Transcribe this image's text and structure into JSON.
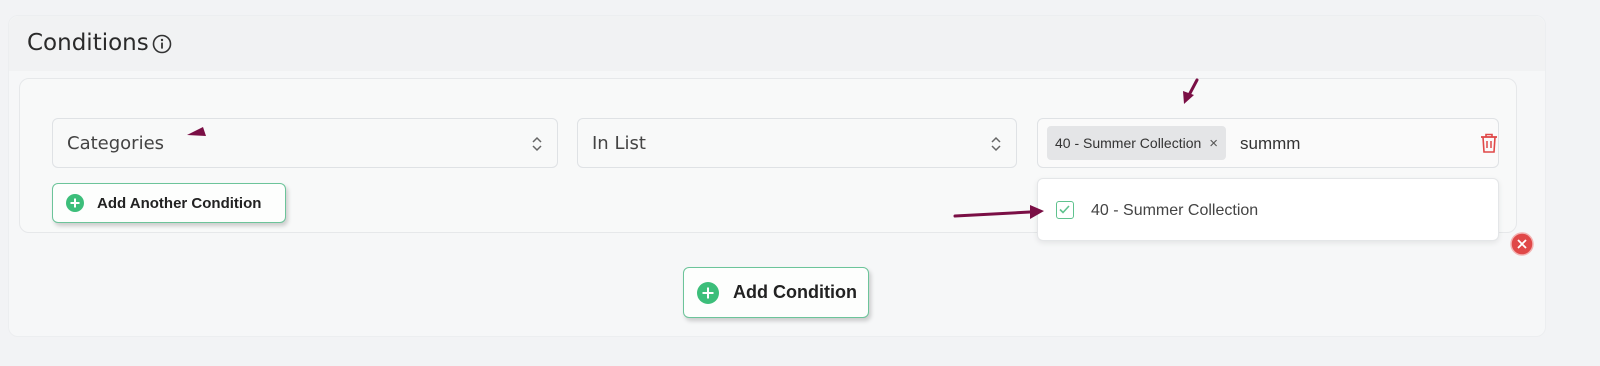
{
  "panel": {
    "title": "Conditions",
    "info_icon": "info-circle-icon"
  },
  "condition": {
    "field": {
      "value": "Categories"
    },
    "operator": {
      "value": "In List"
    },
    "values": {
      "tags": [
        {
          "label": "40 - Summer Collection",
          "remove_glyph": "×"
        }
      ],
      "search_text": "summm"
    },
    "delete_icon": "trash-icon"
  },
  "dropdown": {
    "options": [
      {
        "label": "40 - Summer Collection",
        "checked": true
      }
    ]
  },
  "buttons": {
    "add_another": "Add Another Condition",
    "add_condition": "Add Condition"
  },
  "colors": {
    "accent_green": "#3cbe7a",
    "annotation_arrow": "#7a0f45",
    "danger_red": "#e04848"
  }
}
